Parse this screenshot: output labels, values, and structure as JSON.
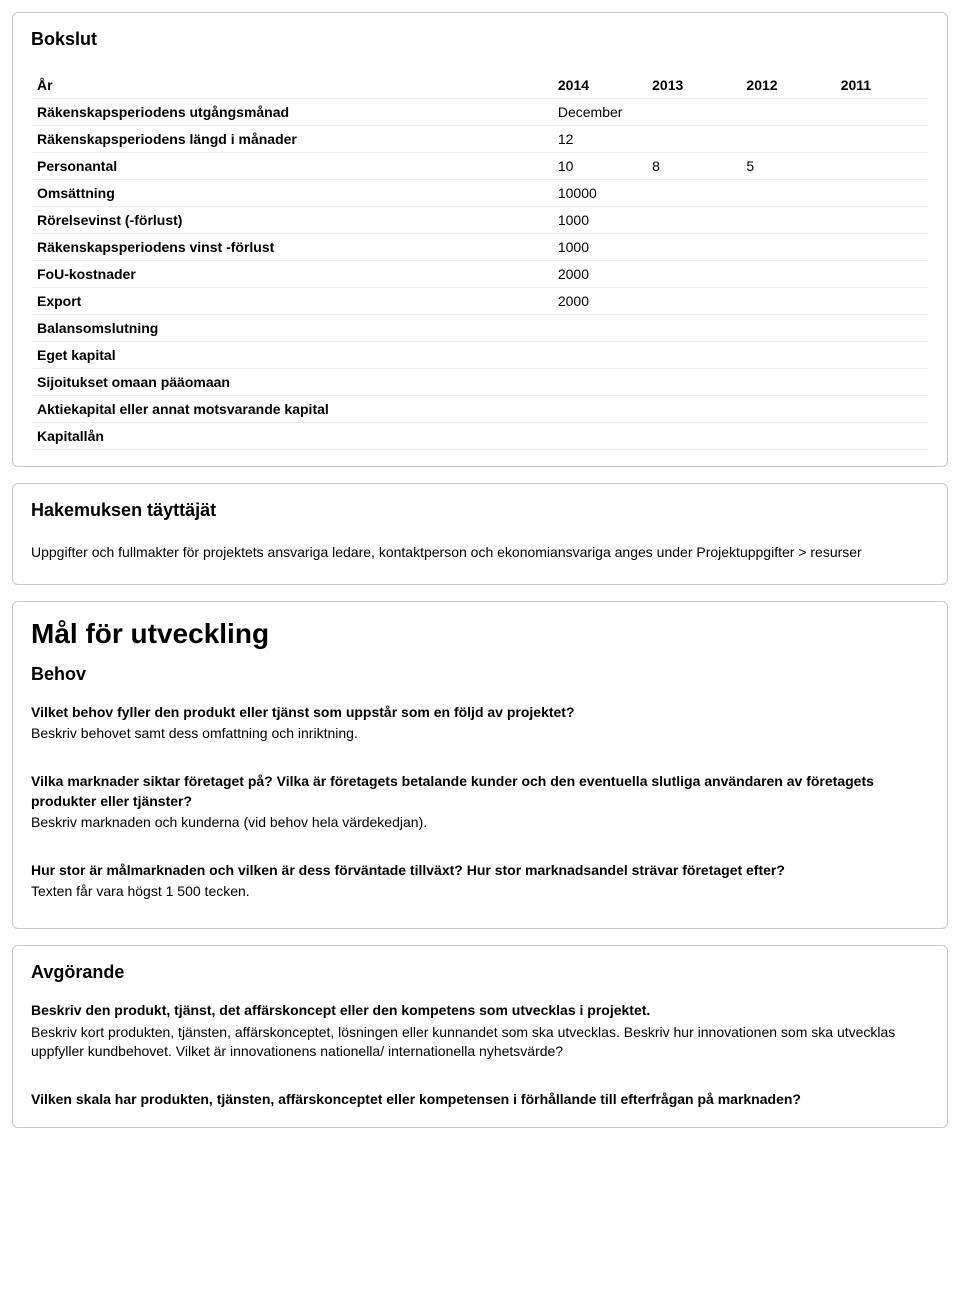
{
  "bokslut": {
    "title": "Bokslut",
    "headers": [
      "År",
      "2014",
      "2013",
      "2012",
      "2011"
    ],
    "rows": [
      {
        "label": "Räkenskapsperiodens utgångsmånad",
        "v": [
          "December",
          "",
          "",
          ""
        ]
      },
      {
        "label": "Räkenskapsperiodens längd i månader",
        "v": [
          "12",
          "",
          "",
          ""
        ]
      },
      {
        "label": "Personantal",
        "v": [
          "10",
          "8",
          "5",
          ""
        ]
      },
      {
        "label": "Omsättning",
        "v": [
          "10000",
          "",
          "",
          ""
        ]
      },
      {
        "label": "Rörelsevinst (-förlust)",
        "v": [
          "1000",
          "",
          "",
          ""
        ]
      },
      {
        "label": "Räkenskapsperiodens vinst -förlust",
        "v": [
          "1000",
          "",
          "",
          ""
        ]
      },
      {
        "label": "FoU-kostnader",
        "v": [
          "2000",
          "",
          "",
          ""
        ]
      },
      {
        "label": "Export",
        "v": [
          "2000",
          "",
          "",
          ""
        ]
      },
      {
        "label": "Balansomslutning",
        "v": [
          "",
          "",
          "",
          ""
        ]
      },
      {
        "label": "Eget kapital",
        "v": [
          "",
          "",
          "",
          ""
        ]
      },
      {
        "label": "Sijoitukset omaan pääomaan",
        "v": [
          "",
          "",
          "",
          ""
        ]
      },
      {
        "label": "Aktiekapital eller annat motsvarande kapital",
        "v": [
          "",
          "",
          "",
          ""
        ]
      },
      {
        "label": "Kapitallån",
        "v": [
          "",
          "",
          "",
          ""
        ]
      }
    ]
  },
  "hakemuksen": {
    "title": "Hakemuksen täyttäjät",
    "text": "Uppgifter och fullmakter för projektets ansvariga ledare, kontaktperson och ekonomiansvariga anges under Projektuppgifter > resurser"
  },
  "mal": {
    "big_title": "Mål för utveckling",
    "sub_title": "Behov",
    "q1_bold": "Vilket behov fyller den produkt eller tjänst som uppstår som en följd av projektet?",
    "q1_desc": "Beskriv behovet samt dess omfattning och inriktning.",
    "q2_bold": "Vilka marknader siktar företaget på? Vilka är företagets betalande kunder och den eventuella slutliga användaren av företagets produkter eller tjänster?",
    "q2_desc": "Beskriv marknaden och kunderna (vid behov hela värdekedjan).",
    "q3_bold": "Hur stor är målmarknaden och vilken är dess förväntade tillväxt? Hur stor marknadsandel strävar företaget efter?",
    "q3_desc": "Texten får vara högst 1 500 tecken."
  },
  "avgorande": {
    "title": "Avgörande",
    "q1_bold": "Beskriv den produkt, tjänst, det affärskoncept eller den kompetens som utvecklas i projektet.",
    "q1_desc": "Beskriv kort produkten, tjänsten, affärskonceptet, lösningen eller kunnandet som ska utvecklas. Beskriv hur innovationen som ska utvecklas uppfyller kundbehovet. Vilket är innovationens nationella/ internationella nyhetsvärde?",
    "q2_bold": "Vilken skala har produkten, tjänsten, affärskonceptet eller kompetensen i förhållande till efterfrågan på marknaden?"
  }
}
